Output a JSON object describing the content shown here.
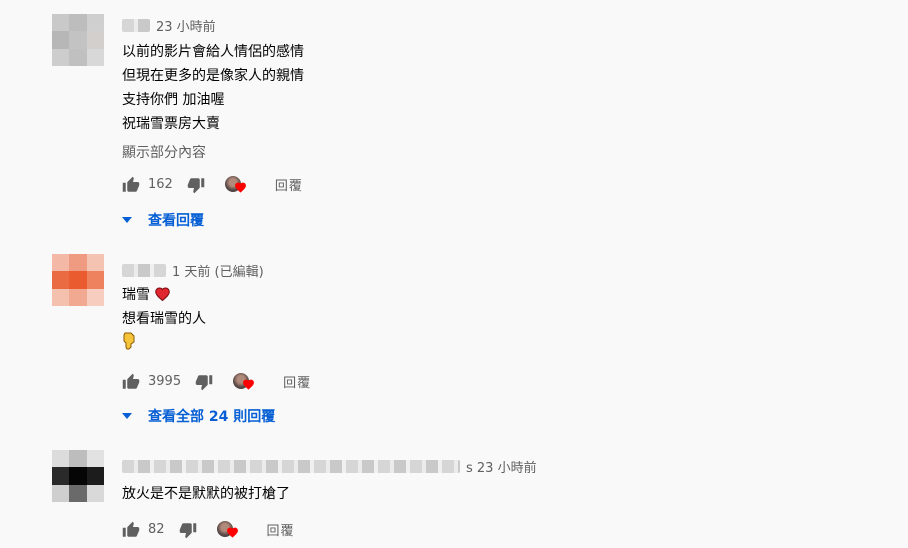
{
  "comments": [
    {
      "time": "23 小時前",
      "lines": [
        "以前的影片會給人情侶的感情",
        "但現在更多的是像家人的親情",
        "支持你們 加油喔",
        "祝瑞雪票房大賣"
      ],
      "show_more": "顯示部分內容",
      "likes": "162",
      "reply_label": "回覆",
      "view_replies": "查看回覆"
    },
    {
      "time": "1 天前 (已編輯)",
      "lines": [
        "瑞雪",
        "想看瑞雪的人",
        ""
      ],
      "likes": "3995",
      "reply_label": "回覆",
      "view_replies": "查看全部 24 則回覆"
    },
    {
      "time": "s 23 小時前",
      "lines": [
        "放火是不是默默的被打槍了"
      ],
      "likes": "82",
      "reply_label": "回覆"
    }
  ],
  "colors": {
    "link": "#065fd4",
    "heart": "#ff0000",
    "muted": "#606060"
  },
  "icons": [
    "thumb-up-icon",
    "thumb-down-icon",
    "creator-heart-icon",
    "caret-down-icon",
    "red-heart-emoji",
    "pointing-down-emoji"
  ]
}
